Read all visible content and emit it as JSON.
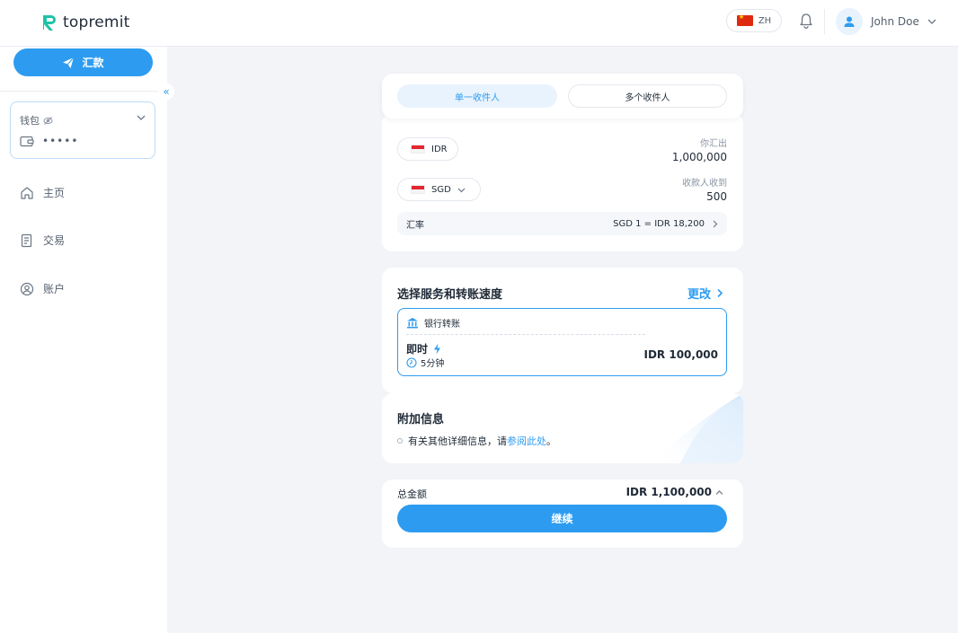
{
  "brand": {
    "name": "topremit",
    "accent_color": "#2d9cf0",
    "logo_color": "#1fc2a8"
  },
  "header": {
    "language": "ZH",
    "language_flag": "china-flag-icon",
    "user_name": "John Doe"
  },
  "sidebar": {
    "send_button": "汇款",
    "wallet": {
      "label": "钱包",
      "balance_masked": "•••••"
    },
    "nav": [
      {
        "label": "主页",
        "icon": "home-icon"
      },
      {
        "label": "交易",
        "icon": "transactions-icon"
      },
      {
        "label": "账户",
        "icon": "account-icon"
      }
    ]
  },
  "recipient_tabs": {
    "single": "单一收件人",
    "multiple": "多个收件人",
    "active": "single"
  },
  "transfer": {
    "send_currency": "IDR",
    "send_label": "你汇出",
    "send_amount": "1,000,000",
    "receive_currency": "SGD",
    "receive_label": "收款人收到",
    "receive_amount": "500",
    "rate_label": "汇率",
    "rate_value": "SGD 1 = IDR 18,200"
  },
  "service": {
    "title": "选择服务和转账速度",
    "change_label": "更改",
    "method": "银行转账",
    "speed": "即时",
    "eta": "5分钟",
    "fee": "IDR 100,000"
  },
  "info": {
    "title": "附加信息",
    "text": "有关其他详细信息，请",
    "link": "参阅此处",
    "suffix": "。"
  },
  "total": {
    "label": "总金额",
    "value": "IDR 1,100,000",
    "continue_label": "继续"
  }
}
